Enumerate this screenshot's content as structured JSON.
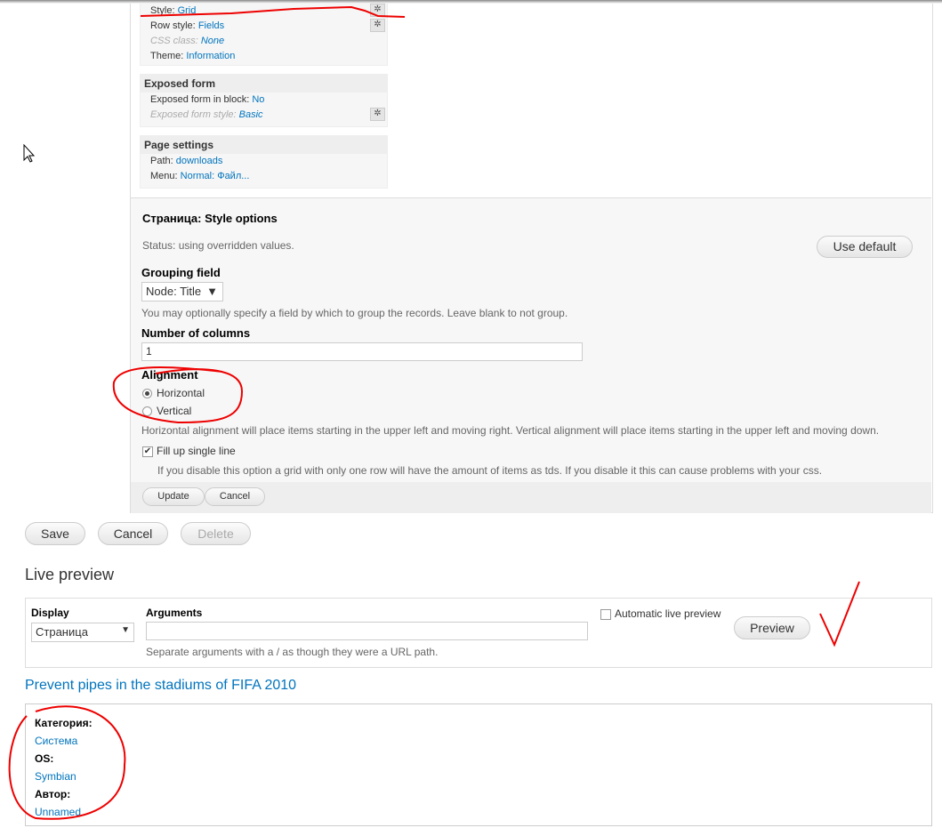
{
  "settings": {
    "format": {
      "style_label": "Style:",
      "style_value": "Grid",
      "row_style_label": "Row style:",
      "row_style_value": "Fields",
      "css_label": "CSS class:",
      "css_value": "None",
      "theme_label": "Theme:",
      "theme_value": "Information"
    },
    "exposed": {
      "title": "Exposed form",
      "block_label": "Exposed form in block:",
      "block_value": "No",
      "style_label": "Exposed form style:",
      "style_value": "Basic"
    },
    "page": {
      "title": "Page settings",
      "path_label": "Path:",
      "path_value": "downloads",
      "menu_label": "Menu:",
      "menu_value": "Normal: Файл..."
    }
  },
  "style_options": {
    "title": "Страница: Style options",
    "status": "Status: using overridden values.",
    "use_default": "Use default",
    "grouping_label": "Grouping field",
    "grouping_value": "Node: Title",
    "grouping_desc": "You may optionally specify a field by which to group the records. Leave blank to not group.",
    "columns_label": "Number of columns",
    "columns_value": "1",
    "alignment_label": "Alignment",
    "horizontal": "Horizontal",
    "vertical": "Vertical",
    "alignment_desc": "Horizontal alignment will place items starting in the upper left and moving right. Vertical alignment will place items starting in the upper left and moving down.",
    "fill_label": "Fill up single line",
    "fill_desc": "If you disable this option a grid with only one row will have the amount of items as tds. If you disable it this can cause problems with your css.",
    "update": "Update",
    "cancel": "Cancel"
  },
  "actions": {
    "save": "Save",
    "cancel": "Cancel",
    "delete": "Delete"
  },
  "preview": {
    "title": "Live preview",
    "display_label": "Display",
    "display_value": "Страница",
    "arguments_label": "Arguments",
    "arguments_value": "",
    "arguments_desc": "Separate arguments with a / as though they were a URL path.",
    "auto_label": "Automatic live preview",
    "preview_button": "Preview",
    "result_title": "Prevent pipes in the stadiums of FIFA 2010",
    "fields": [
      {
        "label": "Категория:",
        "value": "Система"
      },
      {
        "label": "OS:",
        "value": "Symbian"
      },
      {
        "label": "Автор:",
        "value": "Unnamed"
      }
    ]
  }
}
